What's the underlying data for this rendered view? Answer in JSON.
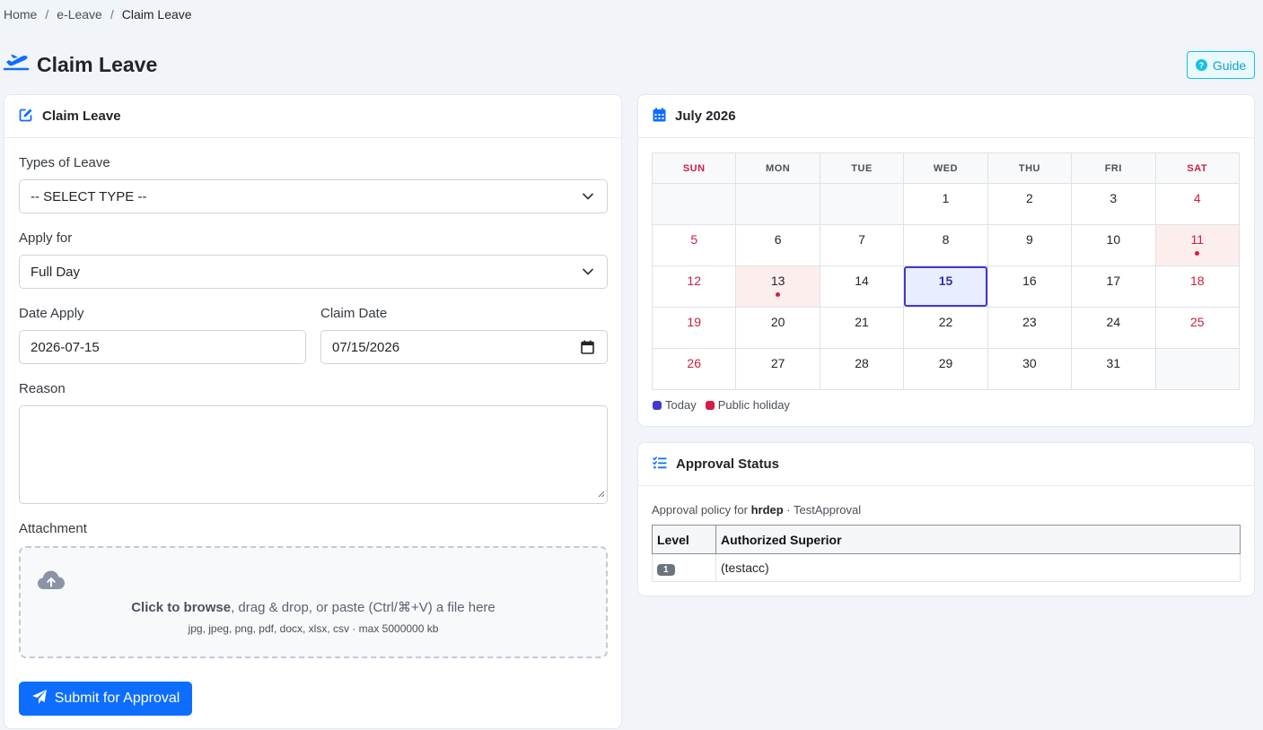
{
  "breadcrumb": {
    "home": "Home",
    "eleave": "e-Leave",
    "current": "Claim Leave",
    "separator": "/"
  },
  "page": {
    "title": "Claim Leave",
    "guide_label": "Guide",
    "guide_icon": "?"
  },
  "form": {
    "card_title": "Claim Leave",
    "leave_type_label": "Types of Leave",
    "leave_type_value": "-- SELECT TYPE --",
    "apply_for_label": "Apply for",
    "apply_for_value": "Full Day",
    "date_apply_label": "Date Apply",
    "date_apply_value": "2026-07-15",
    "claim_date_label": "Claim Date",
    "claim_date_value": "07/15/2026",
    "reason_label": "Reason",
    "reason_value": "",
    "attachment_label": "Attachment",
    "dropzone_bold": "Click to browse",
    "dropzone_text": ", drag & drop, or paste (Ctrl/⌘+V) a file here",
    "dropzone_hint": "jpg, jpeg, png, pdf, docx, xlsx, csv · max 5000000 kb",
    "submit_label": "Submit for Approval"
  },
  "calendar": {
    "title": "July 2026",
    "days": [
      "SUN",
      "MON",
      "TUE",
      "WED",
      "THU",
      "FRI",
      "SAT"
    ],
    "weeks": [
      [
        "",
        "",
        "",
        "1",
        "2",
        "3",
        "4"
      ],
      [
        "5",
        "6",
        "7",
        "8",
        "9",
        "10",
        "11"
      ],
      [
        "12",
        "13",
        "14",
        "15",
        "16",
        "17",
        "18"
      ],
      [
        "19",
        "20",
        "21",
        "22",
        "23",
        "24",
        "25"
      ],
      [
        "26",
        "27",
        "28",
        "29",
        "30",
        "31",
        ""
      ]
    ],
    "today": "15",
    "holidays": [
      "11",
      "13"
    ],
    "legend_today": "Today",
    "legend_holiday": "Public holiday",
    "colors": {
      "today": "#4338ca",
      "holiday": "#d81b45",
      "weekend": "#c8213f"
    }
  },
  "approval": {
    "title": "Approval Status",
    "policy_prefix": "Approval policy for ",
    "policy_dept": "hrdep",
    "policy_suffix": " · TestApproval",
    "headers": [
      "Level",
      "Authorized Superior"
    ],
    "rows": [
      {
        "level": "1",
        "superior": "(testacc)"
      }
    ]
  }
}
